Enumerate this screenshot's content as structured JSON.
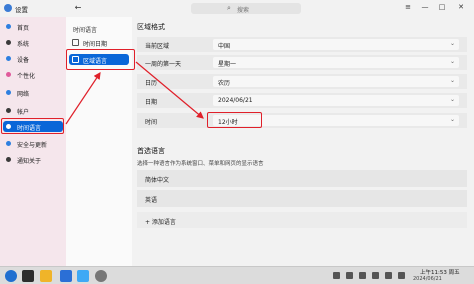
{
  "app": {
    "title": "设置"
  },
  "search": {
    "icon": "search-icon",
    "placeholder": "搜索"
  },
  "window_controls": {
    "menu": "≡",
    "minimize": "—",
    "maximize": "□",
    "close": "✕"
  },
  "sidebar": {
    "items": [
      {
        "label": "首页",
        "icon_color": "#2d7fe0"
      },
      {
        "label": "系统",
        "icon_color": "#3a3a3a"
      },
      {
        "label": "设备",
        "icon_color": "#2d7fe0"
      },
      {
        "label": "个性化",
        "icon_color": "#e05a9b"
      },
      {
        "label": "网络",
        "icon_color": "#2d7fe0"
      },
      {
        "label": "帐户",
        "icon_color": "#3a3a3a"
      },
      {
        "label": "时间语言",
        "icon_color": "#ffffff"
      },
      {
        "label": "安全与更新",
        "icon_color": "#2d7fe0"
      },
      {
        "label": "通知关于",
        "icon_color": "#3a3a3a"
      }
    ]
  },
  "subnav": {
    "header": "时间语言",
    "items": [
      {
        "label": "时间日期"
      },
      {
        "label": "区域语言"
      }
    ]
  },
  "region": {
    "title": "区域格式",
    "rows": [
      {
        "label": "当前区域",
        "value": "中国"
      },
      {
        "label": "一周的第一天",
        "value": "星期一"
      },
      {
        "label": "日历",
        "value": "农历"
      },
      {
        "label": "日期",
        "value": "2024/06/21"
      },
      {
        "label": "时间",
        "value": "12小时"
      }
    ]
  },
  "language": {
    "title": "首选语言",
    "subtitle": "选择一种语言作为系统窗口、菜单和网页的显示语言",
    "items": [
      "简体中文",
      "英语"
    ],
    "add_label": "+ 添加语言"
  },
  "taskbar": {
    "clock_time": "上午11:53 周五",
    "clock_date": "2024/06/21"
  },
  "colors": {
    "accent": "#0a66d8",
    "annotation": "#e0202a"
  }
}
